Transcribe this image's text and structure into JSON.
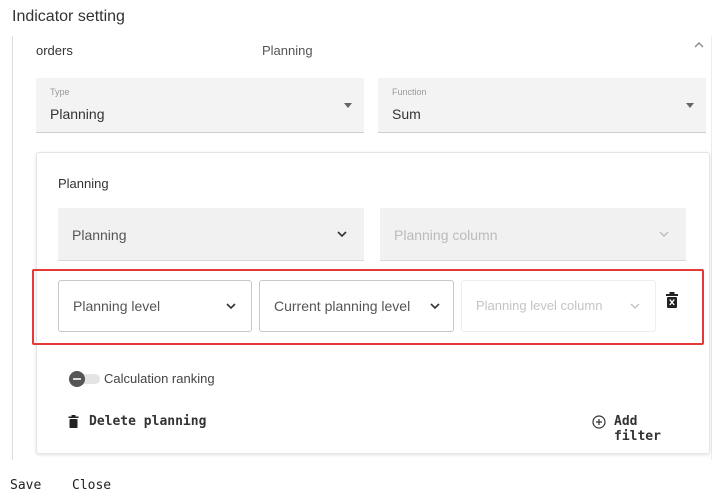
{
  "page": {
    "title": "Indicator setting"
  },
  "indicator": {
    "name": "orders",
    "type_summary": "Planning",
    "type_field": {
      "label": "Type",
      "value": "Planning"
    },
    "function_field": {
      "label": "Function",
      "value": "Sum"
    }
  },
  "planning": {
    "section_title": "Planning",
    "planning_select": "Planning",
    "planning_column": "Planning column",
    "level": {
      "planning_level": "Planning level",
      "current_planning_level": "Current planning level",
      "planning_level_column": "Planning level column"
    },
    "calculation_ranking": {
      "label": "Calculation ranking",
      "on": false
    },
    "delete_label": "Delete planning",
    "add_filter_label": "Add filter"
  },
  "footer": {
    "save": "Save",
    "close": "Close"
  },
  "icons": [
    "chevron-up-icon",
    "dropdown-caret-icon",
    "chevron-down-icon",
    "trash-icon",
    "add-circle-icon"
  ],
  "colors": {
    "highlight": "#e53935"
  }
}
